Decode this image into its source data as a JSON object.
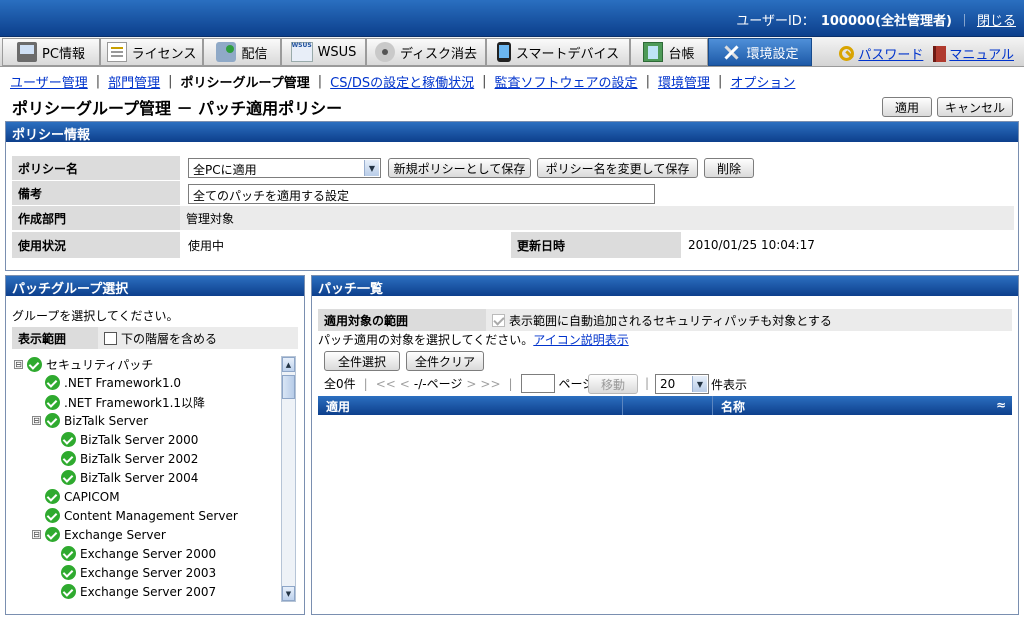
{
  "header": {
    "user_label": "ユーザーID：",
    "user_value": "100000(全社管理者)",
    "separator": "｜",
    "close_link": "閉じる"
  },
  "menu": {
    "tabs": [
      {
        "label": "PC情報",
        "icon": "pc-icon"
      },
      {
        "label": "ライセンス",
        "icon": "license-icon"
      },
      {
        "label": "配信",
        "icon": "distribution-icon"
      },
      {
        "label": "WSUS",
        "icon": "wsus-icon"
      },
      {
        "label": "ディスク消去",
        "icon": "disk-erase-icon"
      },
      {
        "label": "スマートデバイス",
        "icon": "smart-device-icon"
      },
      {
        "label": "台帳",
        "icon": "ledger-icon"
      },
      {
        "label": "環境設定",
        "icon": "tools-icon",
        "active": true
      }
    ],
    "password_link": "パスワード",
    "manual_link": "マニュアル"
  },
  "subnav": {
    "items": [
      "ユーザー管理",
      "部門管理",
      "ポリシーグループ管理",
      "CS/DSの設定と稼働状況",
      "監査ソフトウェアの設定",
      "環境管理",
      "オプション"
    ],
    "current": "ポリシーグループ管理"
  },
  "page": {
    "title": "ポリシーグループ管理 － パッチ適用ポリシー",
    "apply_button": "適用",
    "cancel_button": "キャンセル"
  },
  "policy_info": {
    "header": "ポリシー情報",
    "name_label": "ポリシー名",
    "name_value": "全PCに適用",
    "save_new_button": "新規ポリシーとして保存",
    "rename_save_button": "ポリシー名を変更して保存",
    "delete_button": "削除",
    "note_label": "備考",
    "note_value": "全てのパッチを適用する設定",
    "dept_label": "作成部門",
    "dept_value": "管理対象",
    "usage_label": "使用状況",
    "usage_value": "使用中",
    "updated_label": "更新日時",
    "updated_value": "2010/01/25 10:04:17"
  },
  "patch_group": {
    "header": "パッチグループ選択",
    "instruction": "グループを選択してください。",
    "range_label": "表示範囲",
    "include_lower_label": "下の階層を含める",
    "tree": [
      {
        "label": "セキュリティパッチ",
        "level": 0,
        "toggle": "⊟"
      },
      {
        "label": ".NET Framework1.0",
        "level": 1
      },
      {
        "label": ".NET Framework1.1以降",
        "level": 1
      },
      {
        "label": "BizTalk Server",
        "level": 1,
        "toggle": "⊟"
      },
      {
        "label": "BizTalk Server 2000",
        "level": 2
      },
      {
        "label": "BizTalk Server 2002",
        "level": 2
      },
      {
        "label": "BizTalk Server 2004",
        "level": 2
      },
      {
        "label": "CAPICOM",
        "level": 1
      },
      {
        "label": "Content Management Server",
        "level": 1
      },
      {
        "label": "Exchange Server",
        "level": 1,
        "toggle": "⊟"
      },
      {
        "label": "Exchange Server 2000",
        "level": 2
      },
      {
        "label": "Exchange Server 2003",
        "level": 2
      },
      {
        "label": "Exchange Server 2007",
        "level": 2
      }
    ]
  },
  "patch_list": {
    "header": "パッチ一覧",
    "scope_label": "適用対象の範囲",
    "scope_checkbox_label": "表示範囲に自動追加されるセキュリティパッチも対象とする",
    "instruction": "パッチ適用の対象を選択してください。",
    "icon_help_link": "アイコン説明表示",
    "select_all_button": "全件選択",
    "clear_all_button": "全件クリア",
    "pager": {
      "count": "全0件",
      "first": "<<",
      "prev": "<",
      "page": "-/-ページ",
      "next": ">",
      "last": ">>",
      "goto_suffix": "ページへ",
      "move_button": "移動",
      "per_page": "20",
      "per_page_suffix": "件表示"
    },
    "columns": [
      "適用",
      "",
      "名称"
    ],
    "sort_icon": "≈"
  },
  "colors": {
    "header_blue": "#0d3f8c",
    "active_tab": "#1d5aa8",
    "label_gray": "#dcdcdc",
    "link_blue": "#0033cc",
    "ok_green": "#2faa2f"
  }
}
